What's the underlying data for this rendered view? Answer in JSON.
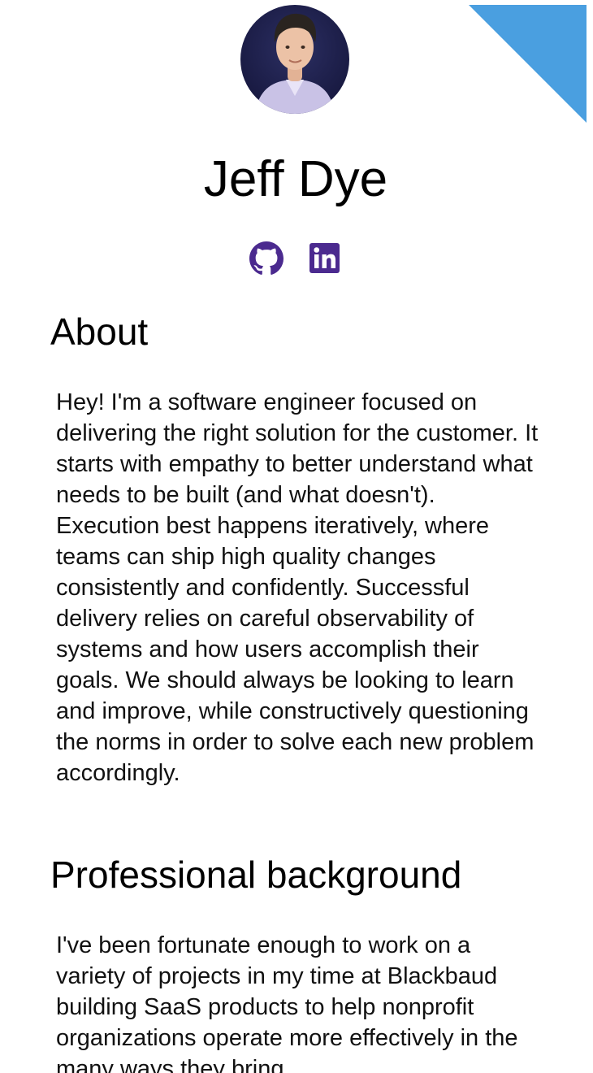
{
  "profile": {
    "name": "Jeff Dye",
    "avatar_icon": "portrait-photo"
  },
  "social": {
    "github_icon": "github-icon",
    "linkedin_icon": "linkedin-icon",
    "icon_color": "#4B2A8F"
  },
  "corner": {
    "icon": "corner-ribbon",
    "color": "#4A9FE0"
  },
  "about": {
    "heading": "About",
    "text": "Hey! I'm a software engineer focused on delivering the right solution for the customer. It starts with empathy to better understand what needs to be built (and what doesn't). Execution best happens iteratively, where teams can ship high quality changes consistently and confidently. Successful delivery relies on careful observability of systems and how users accomplish their goals. We should always be looking to learn and improve, while constructively questioning the norms in order to solve each new problem accordingly."
  },
  "background": {
    "heading": "Professional background",
    "text": "I've been fortunate enough to work on a variety of projects in my time at Blackbaud building SaaS products to help nonprofit organizations operate more effectively in the many ways they bring"
  }
}
